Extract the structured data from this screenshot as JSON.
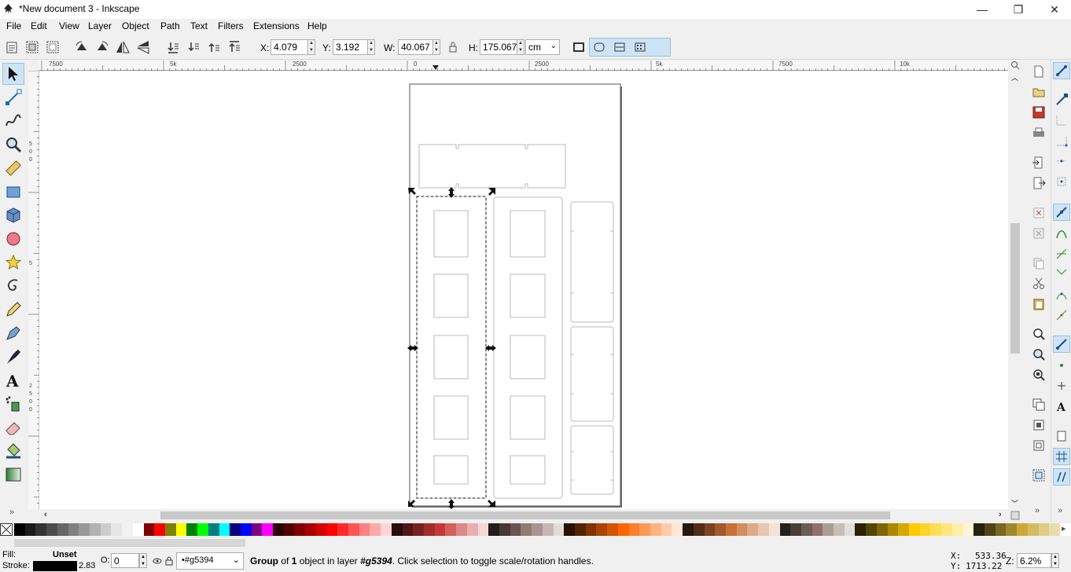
{
  "window": {
    "title": "*New document 3 - Inkscape",
    "minimize": "—",
    "maximize": "❐",
    "close": "✕"
  },
  "menu": [
    "File",
    "Edit",
    "View",
    "Layer",
    "Object",
    "Path",
    "Text",
    "Filters",
    "Extensions",
    "Help"
  ],
  "toolbar": {
    "x_label": "X:",
    "x_value": "4.079",
    "y_label": "Y:",
    "y_value": "3.192",
    "w_label": "W:",
    "w_value": "40.067",
    "h_label": "H:",
    "h_value": "175.067",
    "unit": "cm"
  },
  "ruler": {
    "h_ticks": [
      "7500",
      "5k",
      "2500",
      "0",
      "2500",
      "5k",
      "7500",
      "10k"
    ],
    "v_ticks": [
      "5",
      "0",
      "0",
      "5",
      "2",
      "5",
      "0",
      "0"
    ]
  },
  "palette_colors": [
    "#000000",
    "#1a1a1a",
    "#333333",
    "#4d4d4d",
    "#666666",
    "#808080",
    "#999999",
    "#b3b3b3",
    "#cccccc",
    "#e6e6e6",
    "#f2f2f2",
    "#ffffff",
    "#800000",
    "#ff0000",
    "#808000",
    "#ffff00",
    "#008000",
    "#00ff00",
    "#008080",
    "#00ffff",
    "#000080",
    "#0000ff",
    "#800080",
    "#ff00ff",
    "#2b0000",
    "#550000",
    "#800000",
    "#aa0000",
    "#d40000",
    "#ff0000",
    "#ff2a2a",
    "#ff5555",
    "#ff8080",
    "#ffaaaa",
    "#ffd5d5",
    "#280b0b",
    "#501616",
    "#782121",
    "#a02c2c",
    "#c83737",
    "#d35f5f",
    "#de8787",
    "#e9afaf",
    "#f4d7d7",
    "#241c1c",
    "#483737",
    "#6c5353",
    "#917c6f",
    "#ac9393",
    "#c8b7b7",
    "#e3dbdb",
    "#2b1100",
    "#552200",
    "#803300",
    "#aa4400",
    "#d45500",
    "#ff6600",
    "#ff7f2a",
    "#ff9955",
    "#ffb380",
    "#ffccaa",
    "#ffe6d5",
    "#28170b",
    "#502d16",
    "#784421",
    "#a05a2c",
    "#c87137",
    "#d38d5f",
    "#deaa87",
    "#e9c6af",
    "#f4e3d7",
    "#241f1c",
    "#483e37",
    "#6c5d53",
    "#916f6f",
    "#ac9d93",
    "#c8beb7",
    "#e3dedb",
    "#2b2200",
    "#554400",
    "#806600",
    "#aa8800",
    "#d4aa00",
    "#ffcc00",
    "#ffd42a",
    "#ffdd55",
    "#ffe680",
    "#ffeeaa",
    "#fff6d5",
    "#28220b",
    "#504416",
    "#786721",
    "#a0892c",
    "#c8ab37",
    "#d3bc5f",
    "#decd87",
    "#e9ddaf"
  ],
  "status": {
    "fill_label": "Fill:",
    "fill_value": "Unset",
    "stroke_label": "Stroke:",
    "stroke_width": "2.83",
    "opacity_label": "O:",
    "opacity_value": "0",
    "layer_value": "•#g5394",
    "message_pre": "Group",
    "message_of": " of ",
    "message_count": "1",
    "message_mid": " object in layer ",
    "message_layer": "#g5394",
    "message_post": ". Click selection to toggle scale/rotation handles.",
    "x_label": "X:",
    "x_coord": "533.36",
    "y_label": "Y:",
    "y_coord": "1713.22",
    "z_label": "Z:",
    "zoom": "6.2%"
  }
}
